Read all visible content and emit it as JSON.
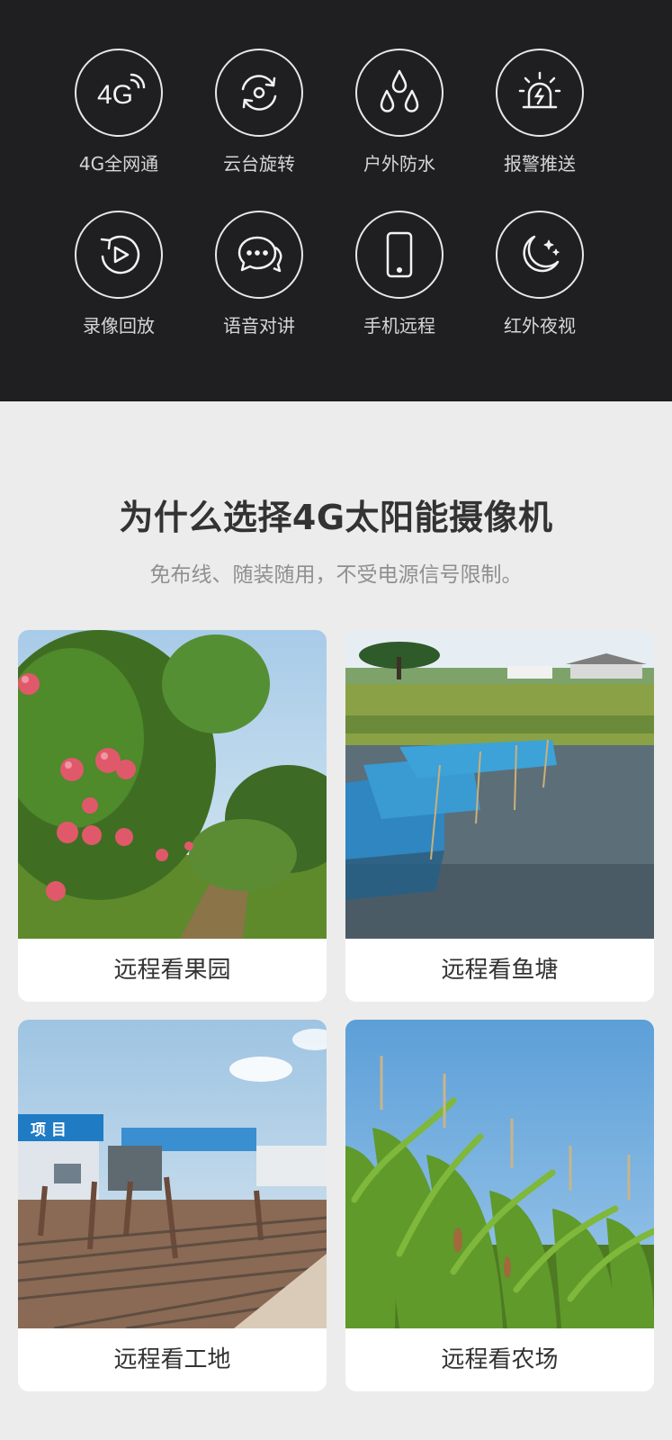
{
  "features": [
    {
      "label": "4G全网通",
      "icon": "4g-icon",
      "icon_text": "4G"
    },
    {
      "label": "云台旋转",
      "icon": "rotate-icon"
    },
    {
      "label": "户外防水",
      "icon": "water-drops-icon"
    },
    {
      "label": "报警推送",
      "icon": "alarm-light-icon"
    },
    {
      "label": "录像回放",
      "icon": "replay-icon"
    },
    {
      "label": "语音对讲",
      "icon": "chat-bubble-icon"
    },
    {
      "label": "手机远程",
      "icon": "phone-icon"
    },
    {
      "label": "红外夜视",
      "icon": "moon-stars-icon"
    }
  ],
  "section": {
    "title": "为什么选择4G太阳能摄像机",
    "subtitle": "免布线、随装随用，不受电源信号限制。"
  },
  "scenes": [
    {
      "label": "远程看果园",
      "image": "apple-orchard-photo"
    },
    {
      "label": "远程看鱼塘",
      "image": "fish-pond-photo"
    },
    {
      "label": "远程看工地",
      "image": "construction-site-photo",
      "sign_text": "项 目"
    },
    {
      "label": "远程看农场",
      "image": "corn-farm-photo"
    }
  ]
}
